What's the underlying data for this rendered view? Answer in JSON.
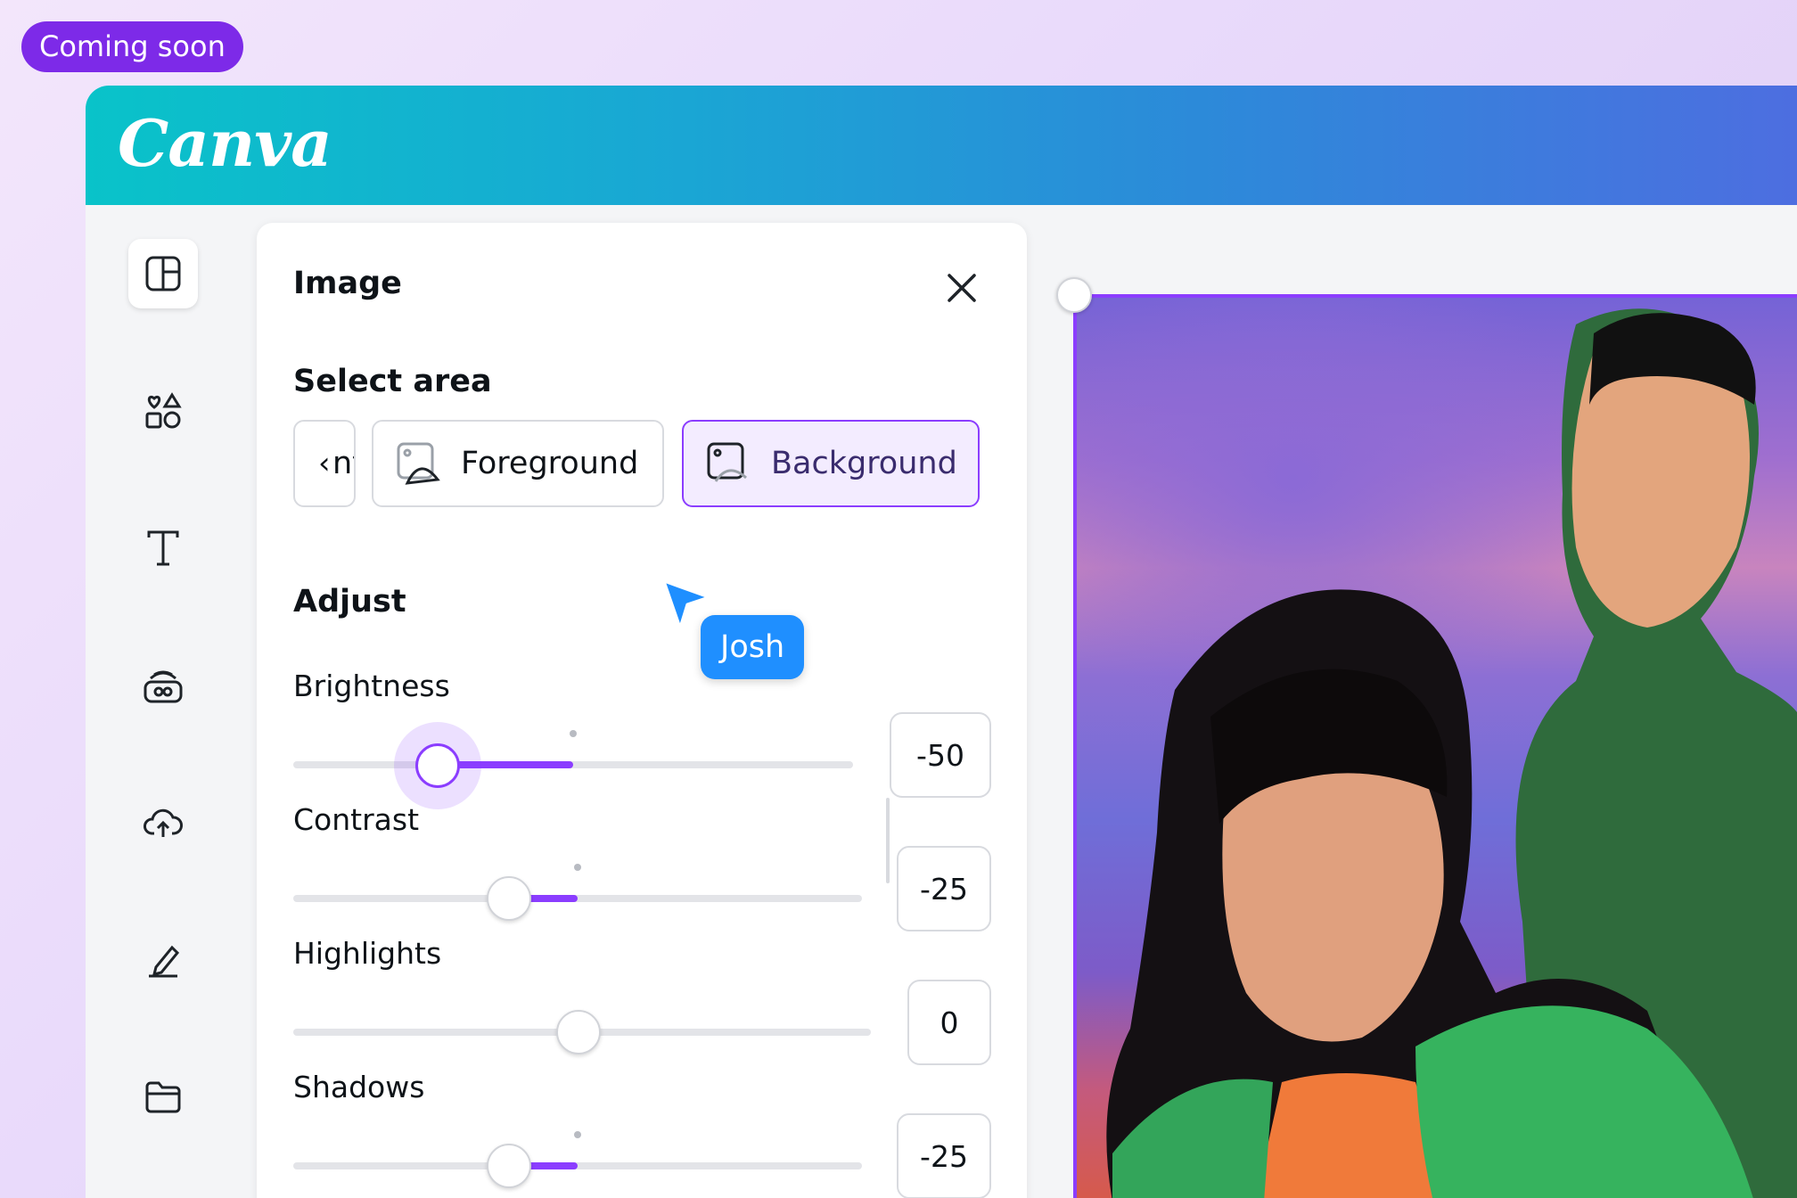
{
  "badge": {
    "label": "Coming soon"
  },
  "header": {
    "logo_text": "Canva"
  },
  "sidebar": {
    "items": [
      {
        "name": "design-icon",
        "active": true
      },
      {
        "name": "elements-icon"
      },
      {
        "name": "text-icon"
      },
      {
        "name": "brand-icon"
      },
      {
        "name": "uploads-icon"
      },
      {
        "name": "draw-icon"
      },
      {
        "name": "projects-icon"
      }
    ]
  },
  "panel": {
    "title": "Image",
    "select_area": {
      "title": "Select area",
      "options": [
        {
          "label": "nt",
          "partial": true
        },
        {
          "label": "Foreground",
          "icon": "foreground-icon"
        },
        {
          "label": "Background",
          "icon": "background-icon",
          "selected": true
        }
      ]
    },
    "adjust": {
      "title": "Adjust",
      "sliders": [
        {
          "label": "Brightness",
          "value": "-50",
          "numeric": -50,
          "min": -100,
          "max": 100,
          "active": true
        },
        {
          "label": "Contrast",
          "value": "-25",
          "numeric": -25,
          "min": -100,
          "max": 100
        },
        {
          "label": "Highlights",
          "value": "0",
          "numeric": 0,
          "min": -100,
          "max": 100
        },
        {
          "label": "Shadows",
          "value": "-25",
          "numeric": -25,
          "min": -100,
          "max": 100
        }
      ]
    }
  },
  "collaborator": {
    "name": "Josh",
    "color": "#1f8fff"
  },
  "colors": {
    "accent": "#8b3dff",
    "badge": "#7d2ae8"
  }
}
